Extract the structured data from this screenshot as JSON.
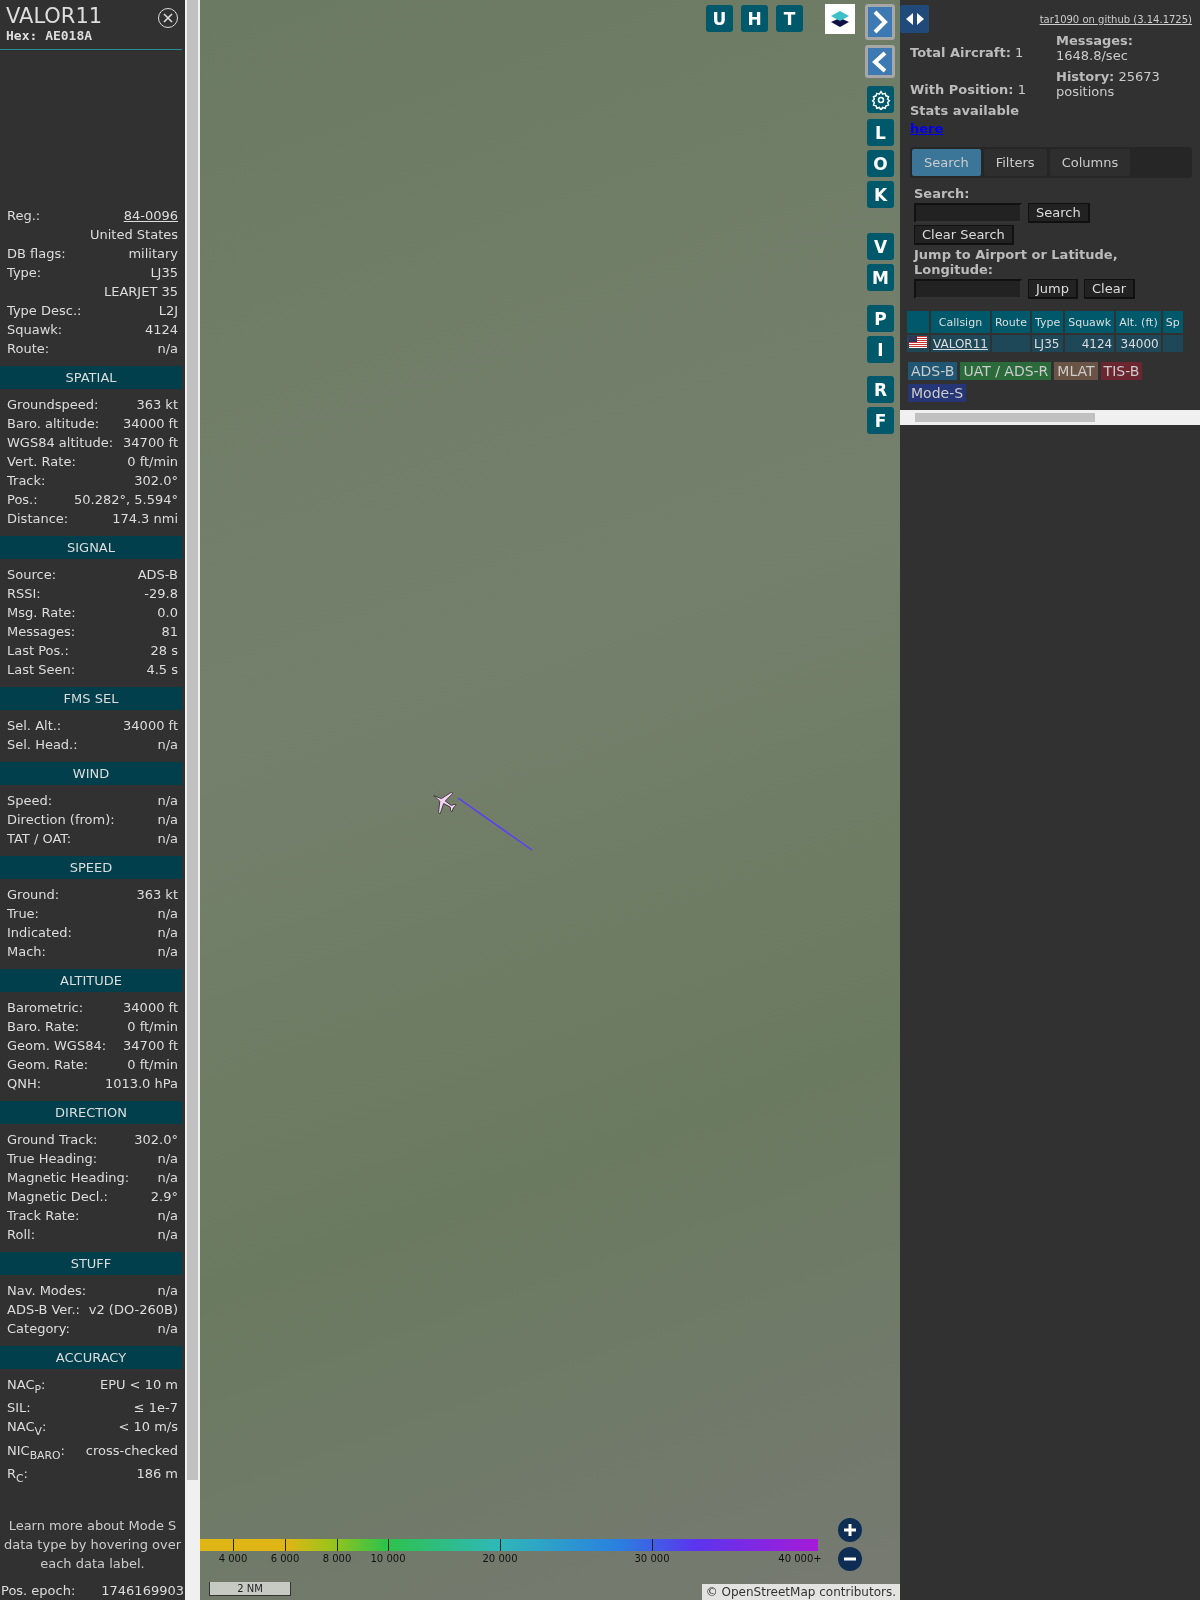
{
  "detail": {
    "callsign": "VALOR11",
    "hex": "Hex: AE018A",
    "info_rows": [
      {
        "label": "Reg.:",
        "value": "84-0096",
        "kind": "link"
      },
      {
        "value": "United States",
        "kind": "text"
      },
      {
        "label": "DB flags:",
        "value": "military",
        "kind": "text"
      },
      {
        "label": "Type:",
        "value": "LJ35",
        "kind": "text"
      },
      {
        "value": "LEARJET 35",
        "kind": "text"
      },
      {
        "label": "Type Desc.:",
        "value": "L2J",
        "kind": "text"
      },
      {
        "label": "Squawk:",
        "value": "4124",
        "kind": "text"
      },
      {
        "label": "Route:",
        "value": "n/a",
        "kind": "text"
      }
    ],
    "sections": [
      {
        "title": "SPATIAL",
        "rows": [
          {
            "label": "Groundspeed:",
            "value": "363 kt"
          },
          {
            "label": "Baro. altitude:",
            "value": "34000 ft"
          },
          {
            "label": "WGS84 altitude:",
            "value": "34700 ft"
          },
          {
            "label": "Vert. Rate:",
            "value": "0 ft/min"
          },
          {
            "label": "Track:",
            "value": "302.0°"
          },
          {
            "label": "Pos.:",
            "value": "50.282°, 5.594°"
          },
          {
            "label": "Distance:",
            "value": "174.3 nmi"
          }
        ]
      },
      {
        "title": "SIGNAL",
        "rows": [
          {
            "label": "Source:",
            "value": "ADS-B"
          },
          {
            "label": "RSSI:",
            "value": "-29.8"
          },
          {
            "label": "Msg. Rate:",
            "value": "0.0"
          },
          {
            "label": "Messages:",
            "value": "81"
          },
          {
            "label": "Last Pos.:",
            "value": "28 s"
          },
          {
            "label": "Last Seen:",
            "value": "4.5 s"
          }
        ]
      },
      {
        "title": "FMS SEL",
        "rows": [
          {
            "label": "Sel. Alt.:",
            "value": "34000 ft"
          },
          {
            "label": "Sel. Head.:",
            "value": "n/a"
          }
        ]
      },
      {
        "title": "WIND",
        "rows": [
          {
            "label": "Speed:",
            "value": "n/a"
          },
          {
            "label": "Direction (from):",
            "value": "n/a"
          },
          {
            "label": "TAT / OAT:",
            "value": "n/a"
          }
        ]
      },
      {
        "title": "SPEED",
        "rows": [
          {
            "label": "Ground:",
            "value": "363 kt"
          },
          {
            "label": "True:",
            "value": "n/a"
          },
          {
            "label": "Indicated:",
            "value": "n/a"
          },
          {
            "label": "Mach:",
            "value": "n/a"
          }
        ]
      },
      {
        "title": "ALTITUDE",
        "rows": [
          {
            "label": "Barometric:",
            "value": "34000 ft"
          },
          {
            "label": "Baro. Rate:",
            "value": "0 ft/min"
          },
          {
            "label": "Geom. WGS84:",
            "value": "34700 ft"
          },
          {
            "label": "Geom. Rate:",
            "value": "0 ft/min"
          },
          {
            "label": "QNH:",
            "value": "1013.0 hPa"
          }
        ]
      },
      {
        "title": "DIRECTION",
        "rows": [
          {
            "label": "Ground Track:",
            "value": "302.0°"
          },
          {
            "label": "True Heading:",
            "value": "n/a"
          },
          {
            "label": "Magnetic Heading:",
            "value": "n/a"
          },
          {
            "label": "Magnetic Decl.:",
            "value": "2.9°"
          },
          {
            "label": "Track Rate:",
            "value": "n/a"
          },
          {
            "label": "Roll:",
            "value": "n/a"
          }
        ]
      },
      {
        "title": "STUFF",
        "rows": [
          {
            "label": "Nav. Modes:",
            "value": "n/a"
          },
          {
            "label": "ADS-B Ver.:",
            "value": "v2 (DO-260B)"
          },
          {
            "label": "Category:",
            "value": "n/a"
          }
        ]
      },
      {
        "title": "ACCURACY",
        "rows": [
          {
            "label": "NAC$_{P}$:",
            "value": "EPU < 10 m"
          },
          {
            "label": "SIL:",
            "value": "≤ 1e-7"
          },
          {
            "label": "NAC$_{V}$:",
            "value": "< 10 m/s"
          },
          {
            "label": "NIC$_{BARO}$:",
            "value": "cross-checked"
          },
          {
            "label": "R$_{C}$:",
            "value": "186 m"
          }
        ]
      }
    ],
    "note": "Learn more about Mode S data type by hovering over each data label.",
    "footer_row": {
      "label": "Pos. epoch:",
      "value": "1746169903"
    }
  },
  "map": {
    "top_buttons": [
      "U",
      "H",
      "T"
    ],
    "side_groups": [
      [
        "L",
        "O",
        "K"
      ],
      [
        "V",
        "M"
      ],
      [
        "P",
        "I"
      ],
      [
        "R",
        "F"
      ]
    ],
    "altitude_scale": [
      "4 000",
      "6 000",
      "8 000",
      "10 000",
      "20 000",
      "30 000",
      "40 000+"
    ],
    "scale_bar": "2 NM",
    "attribution": {
      "prefix": "©",
      "link": "OpenStreetMap",
      "suffix": "contributors."
    }
  },
  "panel": {
    "github_link": "tar1090 on github (3.14.1725)",
    "stats": [
      "**Total Aircraft:** 1",
      "**With Position:** 1"
    ],
    "stats_right": [
      "**Messages:** 1648.8/sec",
      "**History:** 25673 positions"
    ],
    "stats_available": "Stats available",
    "stats_link": "here",
    "tabs": [
      {
        "label": "Search",
        "selected": true
      },
      {
        "label": "Filters",
        "selected": false
      },
      {
        "label": "Columns",
        "selected": false
      }
    ],
    "search_label": "Search:",
    "search_button": "Search",
    "clear_search_button": "Clear Search",
    "jump_label": "Jump to Airport or Latitude, Longitude:",
    "jump_button": "Jump",
    "clear_button": "Clear",
    "table": {
      "columns": [
        "",
        "Callsign",
        "Route",
        "Type",
        "Squawk",
        "Alt. (ft)",
        "Sp"
      ],
      "rows": [
        {
          "callsign": "VALOR11",
          "type": "LJ35",
          "squawk": "4124",
          "altitude": "34000"
        }
      ]
    },
    "sources": [
      {
        "label": "ADS-B",
        "color": "#1f5673"
      },
      {
        "label": "UAT / ADS-R",
        "color": "#2b6b3b"
      },
      {
        "label": "MLAT",
        "color": "#6a5445"
      },
      {
        "label": "TIS-B",
        "color": "#6b2630"
      },
      {
        "label": "Mode-S",
        "color": "#253575"
      }
    ]
  }
}
